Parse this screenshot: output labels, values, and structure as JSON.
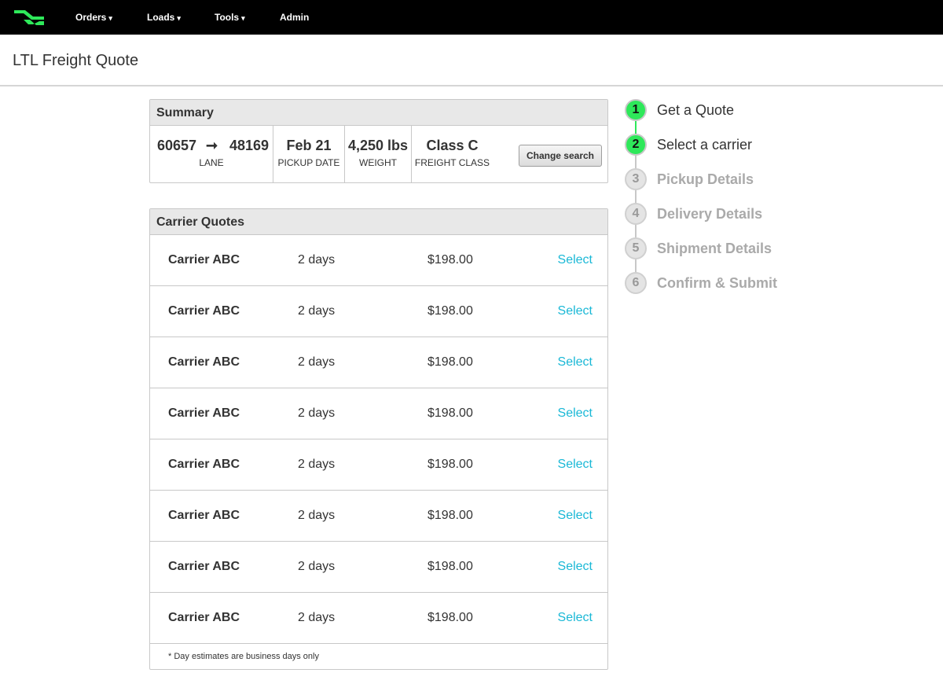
{
  "nav": {
    "items": [
      {
        "label": "Orders",
        "caret": "▾"
      },
      {
        "label": "Loads",
        "caret": "▾"
      },
      {
        "label": "Tools",
        "caret": "▾"
      },
      {
        "label": "Admin",
        "caret": ""
      }
    ],
    "logo_icon": "arrow-logo-icon",
    "logo_color": "#2ee85a"
  },
  "page": {
    "title": "LTL Freight Quote"
  },
  "summary": {
    "heading": "Summary",
    "lane": {
      "from": "60657",
      "arrow": "➞",
      "to": "48169",
      "label": "LANE"
    },
    "pickup": {
      "value": "Feb 21",
      "label": "PICKUP DATE"
    },
    "weight": {
      "value": "4,250 lbs",
      "label": "WEIGHT"
    },
    "freight_class": {
      "value": "Class C",
      "label": "FREIGHT CLASS"
    },
    "change_button": "Change search"
  },
  "quotes": {
    "heading": "Carrier Quotes",
    "rows": [
      {
        "carrier": "Carrier ABC",
        "days": "2 days",
        "price": "$198.00",
        "action": "Select"
      },
      {
        "carrier": "Carrier ABC",
        "days": "2 days",
        "price": "$198.00",
        "action": "Select"
      },
      {
        "carrier": "Carrier ABC",
        "days": "2 days",
        "price": "$198.00",
        "action": "Select"
      },
      {
        "carrier": "Carrier ABC",
        "days": "2 days",
        "price": "$198.00",
        "action": "Select"
      },
      {
        "carrier": "Carrier ABC",
        "days": "2 days",
        "price": "$198.00",
        "action": "Select"
      },
      {
        "carrier": "Carrier ABC",
        "days": "2 days",
        "price": "$198.00",
        "action": "Select"
      },
      {
        "carrier": "Carrier ABC",
        "days": "2 days",
        "price": "$198.00",
        "action": "Select"
      },
      {
        "carrier": "Carrier ABC",
        "days": "2 days",
        "price": "$198.00",
        "action": "Select"
      }
    ],
    "footnote": "* Day estimates are business days only",
    "link_color": "#1ab8d6"
  },
  "steps": {
    "items": [
      {
        "number": "1",
        "label": "Get a Quote",
        "state": "active"
      },
      {
        "number": "2",
        "label": "Select a carrier",
        "state": "active"
      },
      {
        "number": "3",
        "label": "Pickup Details",
        "state": "inactive"
      },
      {
        "number": "4",
        "label": "Delivery Details",
        "state": "inactive"
      },
      {
        "number": "5",
        "label": "Shipment Details",
        "state": "inactive"
      },
      {
        "number": "6",
        "label": "Confirm & Submit",
        "state": "inactive"
      }
    ],
    "active_color": "#2ee85a"
  }
}
